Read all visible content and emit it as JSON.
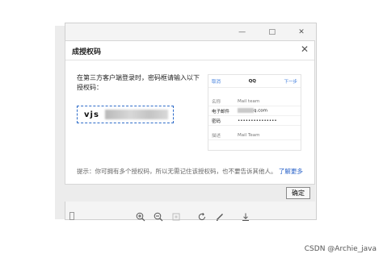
{
  "window": {
    "controls": [
      "—",
      "□",
      "✕"
    ]
  },
  "dialog": {
    "title": "成授权码",
    "close": "✕",
    "instruction": "在第三方客户端登录时，密码框请输入以下授权码：",
    "auth_code_prefix": "vjs",
    "tip": "提示：你可拥有多个授权码，所以无需记住该授权码，也不要告诉其他人。",
    "learn_more": "了解更多"
  },
  "phone_mock": {
    "cancel": "取消",
    "title": "QQ",
    "next": "下一步",
    "rows": [
      {
        "label": "名称",
        "value": "Mail team"
      },
      {
        "label": "电子邮件",
        "value_suffix": "q.com"
      },
      {
        "label": "密码",
        "value": "•••••••••••••••"
      },
      {
        "label": "描述",
        "value": "Mail Team"
      }
    ]
  },
  "footer": {
    "ok_label": "确定"
  },
  "watermark": "CSDN @Archie_java",
  "colors": {
    "accent": "#2a63c9",
    "dialog_bg": "#ffffff",
    "footer_bg": "#ececec"
  },
  "toolbar_icons": [
    "zoom-in-icon",
    "zoom-out-icon",
    "fit-icon",
    "rotate-icon",
    "edit-icon",
    "download-icon"
  ]
}
